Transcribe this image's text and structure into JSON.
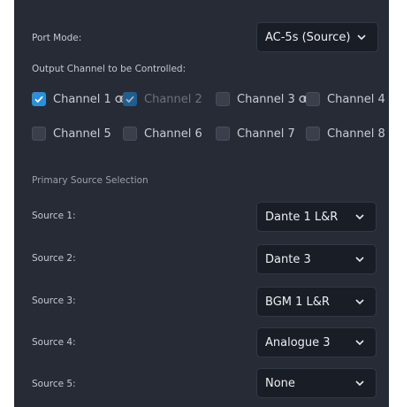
{
  "port_mode": {
    "label": "Port Mode:",
    "value": "AC-5s (Source)"
  },
  "output_channels": {
    "heading": "Output Channel to be Controlled:",
    "channels": [
      {
        "label": "Channel 1",
        "checked": true,
        "linked": true
      },
      {
        "label": "Channel 2",
        "checked": true,
        "dimmed": true
      },
      {
        "label": "Channel 3",
        "checked": false,
        "linked": true
      },
      {
        "label": "Channel 4",
        "checked": false
      },
      {
        "label": "Channel 5",
        "checked": false
      },
      {
        "label": "Channel 6",
        "checked": false
      },
      {
        "label": "Channel 7",
        "checked": false
      },
      {
        "label": "Channel 8",
        "checked": false
      }
    ]
  },
  "primary_source": {
    "heading": "Primary Source Selection",
    "sources": [
      {
        "label": "Source 1:",
        "value": "Dante 1 L&R"
      },
      {
        "label": "Source 2:",
        "value": "Dante 3"
      },
      {
        "label": "Source 3:",
        "value": "BGM 1 L&R"
      },
      {
        "label": "Source 4:",
        "value": "Analogue 3"
      },
      {
        "label": "Source 5:",
        "value": "None"
      }
    ]
  },
  "icons": {
    "checkmark": "check-icon",
    "link": "link-icon",
    "dropdown": "chevron-down-icon"
  },
  "colors": {
    "panel_bg": "#272b35",
    "select_bg": "#191d25",
    "accent": "#2b8fd9"
  }
}
